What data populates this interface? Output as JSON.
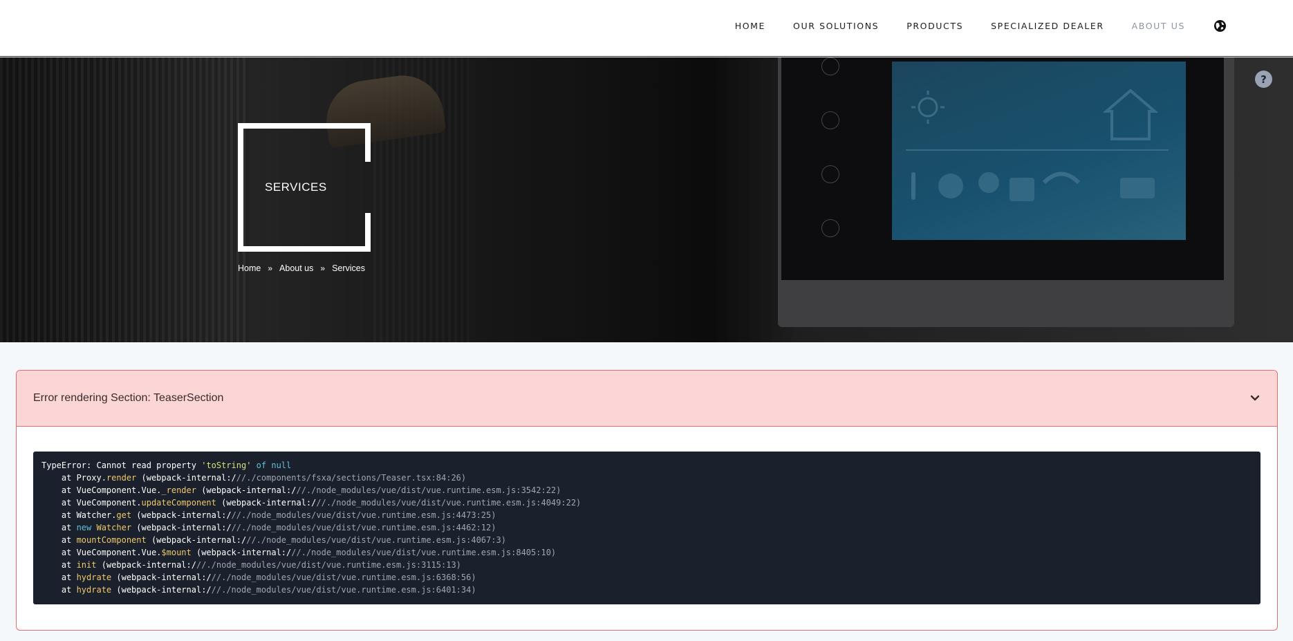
{
  "nav": {
    "items": [
      "HOME",
      "OUR SOLUTIONS",
      "PRODUCTS",
      "SPECIALIZED DEALER",
      "ABOUT US"
    ],
    "active": "ABOUT US",
    "language_icon": "globe-icon"
  },
  "hero": {
    "title": "SERVICES",
    "help_label": "?",
    "breadcrumb": [
      "Home",
      "About us",
      "Services"
    ],
    "breadcrumb_separator": "»"
  },
  "error": {
    "title": "Error rendering Section: TeaserSection",
    "toggle_icon": "chevron-down-icon",
    "stack": [
      {
        "parts": [
          [
            "TypeError: Cannot read property ",
            "plain"
          ],
          [
            "'toString'",
            "str"
          ],
          [
            " of ",
            "kw"
          ],
          [
            "null",
            "kw"
          ]
        ]
      },
      {
        "parts": [
          [
            "    at Proxy.",
            "plain"
          ],
          [
            "render",
            "fn"
          ],
          [
            " (webpack-internal:/",
            "plain"
          ],
          [
            "//./components/fsxa/sections/Teaser.tsx:84:26)",
            "dim"
          ]
        ]
      },
      {
        "parts": [
          [
            "    at VueComponent.Vue.",
            "plain"
          ],
          [
            "_render",
            "fn"
          ],
          [
            " (webpack-internal:/",
            "plain"
          ],
          [
            "//./node_modules/vue/dist/vue.runtime.esm.js:3542:22)",
            "dim"
          ]
        ]
      },
      {
        "parts": [
          [
            "    at VueComponent.",
            "plain"
          ],
          [
            "updateComponent",
            "fn"
          ],
          [
            " (webpack-internal:/",
            "plain"
          ],
          [
            "//./node_modules/vue/dist/vue.runtime.esm.js:4049:22)",
            "dim"
          ]
        ]
      },
      {
        "parts": [
          [
            "    at Watcher.",
            "plain"
          ],
          [
            "get",
            "fn"
          ],
          [
            " (webpack-internal:/",
            "plain"
          ],
          [
            "//./node_modules/vue/dist/vue.runtime.esm.js:4473:25)",
            "dim"
          ]
        ]
      },
      {
        "parts": [
          [
            "    at ",
            "plain"
          ],
          [
            "new ",
            "kw"
          ],
          [
            "Watcher",
            "fn"
          ],
          [
            " (webpack-internal:/",
            "plain"
          ],
          [
            "//./node_modules/vue/dist/vue.runtime.esm.js:4462:12)",
            "dim"
          ]
        ]
      },
      {
        "parts": [
          [
            "    at ",
            "plain"
          ],
          [
            "mountComponent",
            "fn"
          ],
          [
            " (webpack-internal:/",
            "plain"
          ],
          [
            "//./node_modules/vue/dist/vue.runtime.esm.js:4067:3)",
            "dim"
          ]
        ]
      },
      {
        "parts": [
          [
            "    at VueComponent.Vue.",
            "plain"
          ],
          [
            "$mount",
            "fn"
          ],
          [
            " (webpack-internal:/",
            "plain"
          ],
          [
            "//./node_modules/vue/dist/vue.runtime.esm.js:8405:10)",
            "dim"
          ]
        ]
      },
      {
        "parts": [
          [
            "    at ",
            "plain"
          ],
          [
            "init",
            "fn"
          ],
          [
            " (webpack-internal:/",
            "plain"
          ],
          [
            "//./node_modules/vue/dist/vue.runtime.esm.js:3115:13)",
            "dim"
          ]
        ]
      },
      {
        "parts": [
          [
            "    at ",
            "plain"
          ],
          [
            "hydrate",
            "fn"
          ],
          [
            " (webpack-internal:/",
            "plain"
          ],
          [
            "//./node_modules/vue/dist/vue.runtime.esm.js:6368:56)",
            "dim"
          ]
        ]
      },
      {
        "parts": [
          [
            "    at ",
            "plain"
          ],
          [
            "hydrate",
            "fn"
          ],
          [
            " (webpack-internal:/",
            "plain"
          ],
          [
            "//./node_modules/vue/dist/vue.runtime.esm.js:6401:34)",
            "dim"
          ]
        ]
      }
    ]
  },
  "colors": {
    "error_bg": "#fcd5d7",
    "error_border": "#e46b6b",
    "code_bg": "#1a202c",
    "nav_active": "#8e95a3"
  }
}
